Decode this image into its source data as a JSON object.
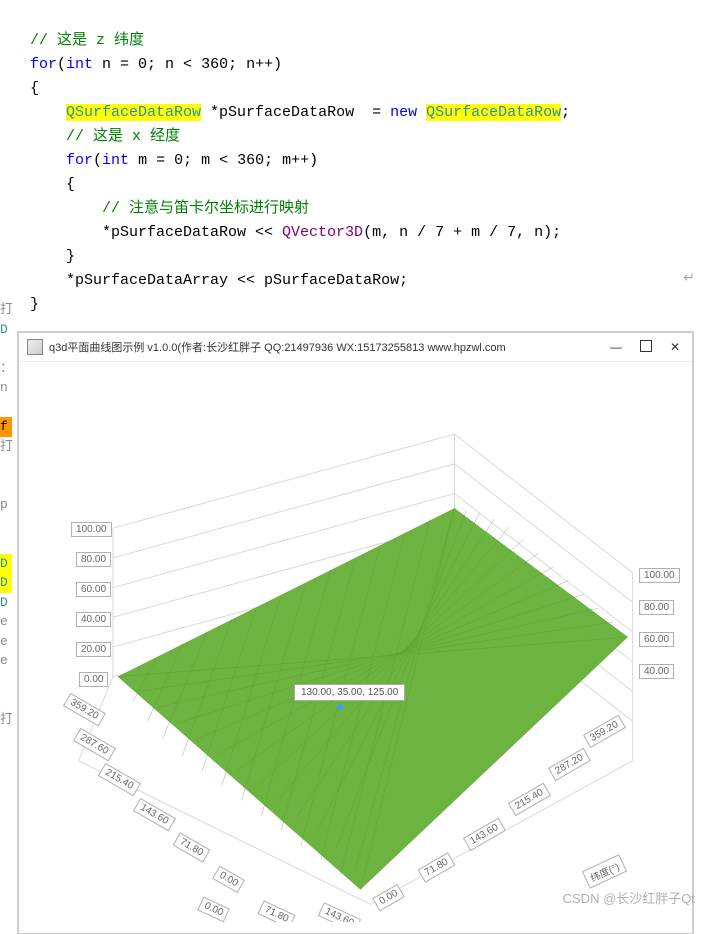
{
  "code": {
    "c1": "// 这是 z 纬度",
    "for1_kw": "for",
    "for1_type": "int",
    "for1_rest": " n = 0; n < 360; n++)",
    "qsurf": "QSurfaceDataRow",
    "ptrdecl": " *pSurfaceDataRow  = ",
    "newkw": "new",
    "semicolon": ";",
    "c2": "// 这是 x 经度",
    "for2_kw": "for",
    "for2_type": "int",
    "for2_rest": " m = 0; m < 360; m++)",
    "c3": "// 注意与笛卡尔坐标进行映射",
    "deref": "*pSurfaceDataRow << ",
    "qvec": "QVector3D",
    "args": "(m, n / 7 + m / 7, n);",
    "arrpush": "*pSurfaceDataArray << pSurfaceDataRow;"
  },
  "window": {
    "title": "q3d平面曲线图示例 v1.0.0(作者:长沙红胖子 QQ:21497936 WX:15173255813 www.hpzwl.com",
    "min": "—",
    "close": "✕"
  },
  "tooltip": "130.00, 35.00, 125.00",
  "axis": {
    "y": [
      "100.00",
      "80.00",
      "60.00",
      "40.00",
      "20.00",
      "0.00"
    ],
    "left_diag": [
      "359.20",
      "287.60",
      "215.40",
      "143.60",
      "71.80",
      "0.00"
    ],
    "right_diag_far": [
      "100.00",
      "80.00",
      "60.00",
      "40.00"
    ],
    "bottom_right": [
      "359.20",
      "287.20",
      "215.40",
      "143.60",
      "71.80",
      "0.00"
    ],
    "bottom_left": [
      "0.00",
      "71.80",
      "143.60"
    ],
    "right_label": "纬度(°)"
  },
  "left_strip": [
    "打",
    "D",
    "",
    "：",
    "n",
    "",
    "f",
    "打",
    "",
    "",
    "p",
    "",
    "",
    "D",
    "D",
    "D",
    "e",
    "e",
    "e",
    "",
    "",
    "打"
  ],
  "chart_data": {
    "type": "surface",
    "x_range": [
      0,
      360
    ],
    "z_range": [
      0,
      360
    ],
    "y_range": [
      0,
      100
    ],
    "formula": "y = n/7 + m/7",
    "selected_point": [
      130.0,
      35.0,
      125.0
    ],
    "y_ticks": [
      0,
      20,
      40,
      60,
      80,
      100
    ],
    "xz_ticks": [
      0.0,
      71.8,
      143.6,
      215.4,
      287.6,
      359.2
    ],
    "xlabel": "",
    "zlabel": "纬度(°)",
    "ylabel": ""
  },
  "watermark": "CSDN @长沙红胖子Qt"
}
